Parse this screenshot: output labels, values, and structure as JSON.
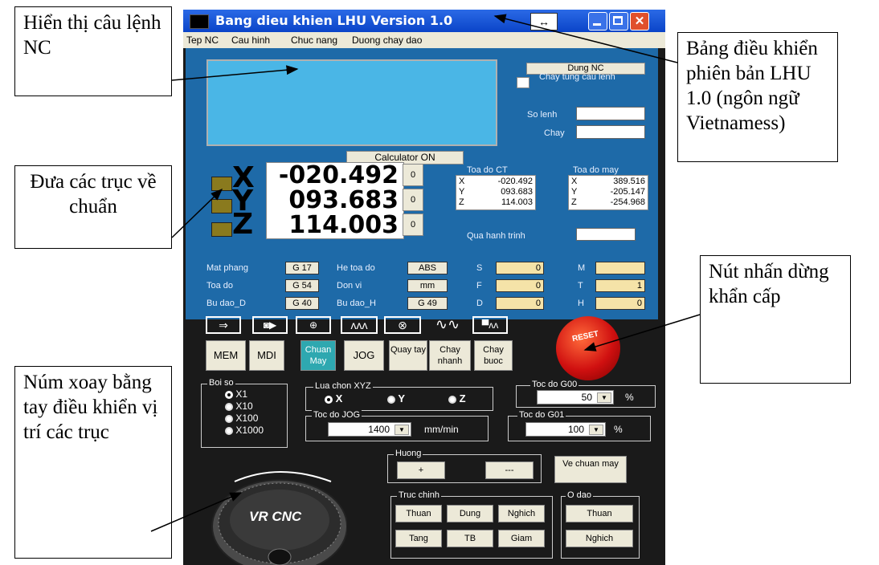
{
  "window": {
    "title": "Bang dieu khien LHU Version 1.0",
    "arrows_icon": "↔",
    "menu": [
      "Tep NC",
      "Cau hinh",
      "Chuc nang",
      "Duong chay dao"
    ]
  },
  "nc_panel": {
    "stop_button": "Dung NC",
    "step_checkbox": "Chay tung cau lenh",
    "so_lenh_label": "So lenh",
    "chay_label": "Chay",
    "calculator_button": "Calculator ON"
  },
  "axes": [
    {
      "name": "X",
      "value": "-020.492",
      "btn": "0"
    },
    {
      "name": "Y",
      "value": "093.683",
      "btn": "0"
    },
    {
      "name": "Z",
      "value": "114.003",
      "btn": "0"
    }
  ],
  "coords_ct": {
    "title": "Toa do CT",
    "rows": [
      [
        "X",
        "-020.492"
      ],
      [
        "Y",
        "093.683"
      ],
      [
        "Z",
        "114.003"
      ]
    ]
  },
  "coords_may": {
    "title": "Toa do may",
    "rows": [
      [
        "X",
        "389.516"
      ],
      [
        "Y",
        "-205.147"
      ],
      [
        "Z",
        "-254.968"
      ]
    ]
  },
  "qua_hanh_trinh": "Qua hanh trinh",
  "params": {
    "mat_phang": "Mat phang",
    "mat_phang_v": "G 17",
    "toa_do": "Toa do",
    "toa_do_v": "G 54",
    "bu_dao_d": "Bu dao_D",
    "bu_dao_d_v": "G 40",
    "he_toa_do": "He toa do",
    "he_toa_do_v": "ABS",
    "don_vi": "Don vi",
    "don_vi_v": "mm",
    "bu_dao_h": "Bu dao_H",
    "bu_dao_h_v": "G 49",
    "s": "S",
    "s_v": "0",
    "f": "F",
    "f_v": "0",
    "d": "D",
    "d_v": "0",
    "m": "M",
    "m_v": "",
    "t": "T",
    "t_v": "1",
    "h": "H",
    "h_v": "0"
  },
  "modes": [
    "MEM",
    "MDI",
    "Chuan May",
    "JOG",
    "Quay tay",
    "Chay nhanh",
    "Chay buoc"
  ],
  "estop_label": "RESET",
  "boi_so": {
    "title": "Boi so",
    "options": [
      "X1",
      "X10",
      "X100",
      "X1000"
    ]
  },
  "lua_chon": {
    "title": "Lua chon XYZ",
    "options": [
      "X",
      "Y",
      "Z"
    ]
  },
  "toc_do_g00": {
    "title": "Toc do G00",
    "value": "50",
    "unit": "%"
  },
  "toc_do_jog": {
    "title": "Toc do JOG",
    "value": "1400",
    "unit": "mm/min"
  },
  "toc_do_g01": {
    "title": "Toc do G01",
    "value": "100",
    "unit": "%"
  },
  "huong": {
    "title": "Huong",
    "plus": "+",
    "minus": "---"
  },
  "ve_chuan": "Ve chuan may",
  "truc_chinh": {
    "title": "Truc chinh",
    "buttons": [
      "Thuan",
      "Dung",
      "Nghich",
      "Tang",
      "TB",
      "Giam"
    ]
  },
  "o_dao": {
    "title": "O dao",
    "buttons": [
      "Thuan",
      "Nghich"
    ]
  },
  "wheel_label": "VR CNC",
  "callouts": {
    "nc_display": "Hiển thị câu lệnh NC",
    "version": "Bảng điều khiển phiên bản LHU 1.0 (ngôn ngữ Vietnamess)",
    "axis_home": "Đưa các trục về chuẩn",
    "estop": "Nút nhấn dừng khẩn cấp",
    "handwheel": "Núm xoay bằng tay điều khiển vị trí các trục"
  }
}
